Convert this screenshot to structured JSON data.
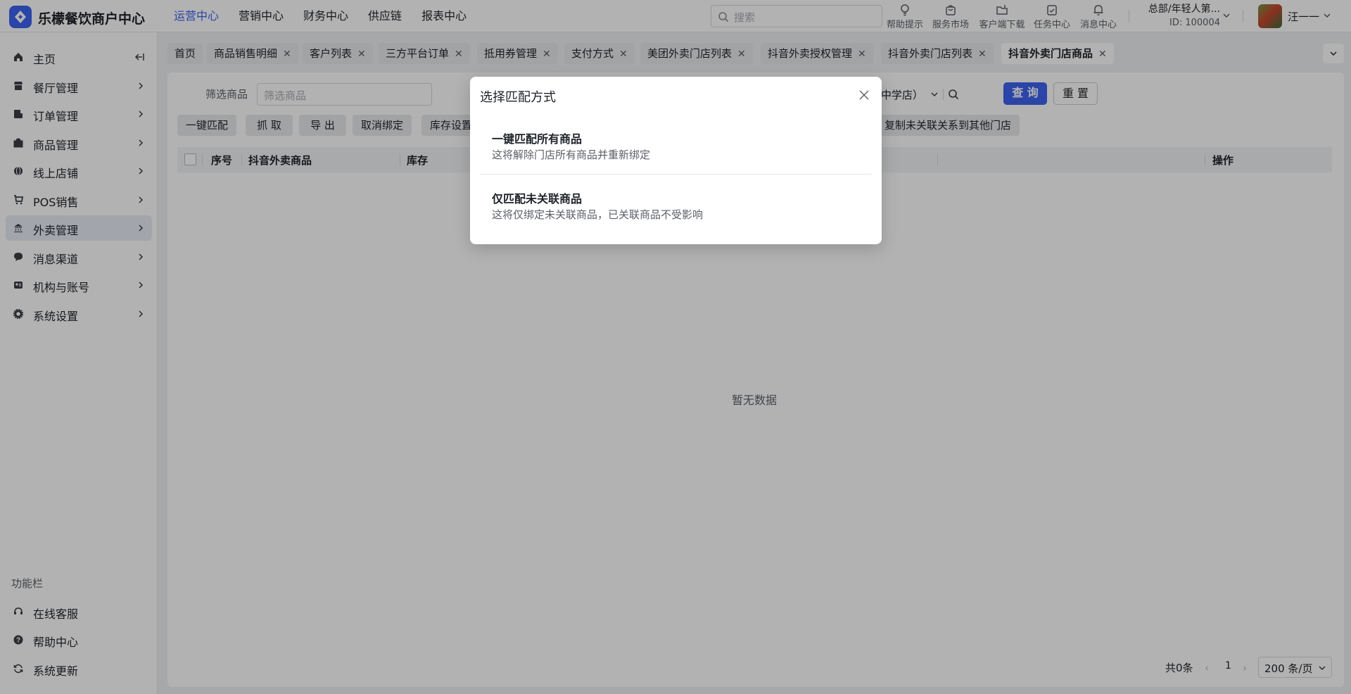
{
  "app": {
    "brand": "乐檬餐饮商户中心"
  },
  "topnav": [
    {
      "label": "运营中心",
      "active": true
    },
    {
      "label": "营销中心"
    },
    {
      "label": "财务中心"
    },
    {
      "label": "供应链"
    },
    {
      "label": "报表中心"
    }
  ],
  "search": {
    "placeholder": "搜索"
  },
  "tools": [
    "帮助提示",
    "服务市场",
    "客户端下载",
    "任务中心",
    "消息中心"
  ],
  "user": {
    "org": "总部/年轻人第...",
    "id": "ID: 100004",
    "name": "汪一一"
  },
  "sidebar": {
    "items": [
      {
        "label": "主页"
      },
      {
        "label": "餐厅管理"
      },
      {
        "label": "订单管理"
      },
      {
        "label": "商品管理"
      },
      {
        "label": "线上店铺"
      },
      {
        "label": "POS销售"
      },
      {
        "label": "外卖管理",
        "active": true
      },
      {
        "label": "消息渠道"
      },
      {
        "label": "机构与账号"
      },
      {
        "label": "系统设置"
      }
    ],
    "function_title": "功能栏",
    "function_items": [
      {
        "label": "在线客服"
      },
      {
        "label": "帮助中心"
      },
      {
        "label": "系统更新"
      }
    ]
  },
  "tabs": [
    {
      "label": "首页"
    },
    {
      "label": "商品销售明细"
    },
    {
      "label": "客户列表"
    },
    {
      "label": "三方平台订单"
    },
    {
      "label": "抵用券管理"
    },
    {
      "label": "支付方式"
    },
    {
      "label": "美团外卖门店列表"
    },
    {
      "label": "抖音外卖授权管理"
    },
    {
      "label": "抖音外卖门店列表"
    },
    {
      "label": "抖音外卖门店商品",
      "active": true
    }
  ],
  "filter": {
    "label": "筛选商品",
    "placeholder": "筛选商品",
    "store_value": "中学店）",
    "query_label": "查 询",
    "reset_label": "重 置"
  },
  "actions": [
    "一键匹配",
    "抓 取",
    "导 出",
    "取消绑定",
    "库存设置",
    "复制未关联关系到其他门店"
  ],
  "table": {
    "columns": [
      "序号",
      "抖音外卖商品",
      "库存",
      "操作"
    ],
    "empty_text": "暂无数据"
  },
  "pagination": {
    "total": "共0条",
    "page": "1",
    "page_size": "200 条/页"
  },
  "modal": {
    "title": "选择匹配方式",
    "options": [
      {
        "title": "一键匹配所有商品",
        "desc": "这将解除门店所有商品并重新绑定"
      },
      {
        "title": "仅匹配未关联商品",
        "desc": "这将仅绑定未关联商品，已关联商品不受影响"
      }
    ]
  },
  "colors": {
    "accent": "#3d63f0",
    "mask": "rgba(0,0,0,0.30)"
  }
}
